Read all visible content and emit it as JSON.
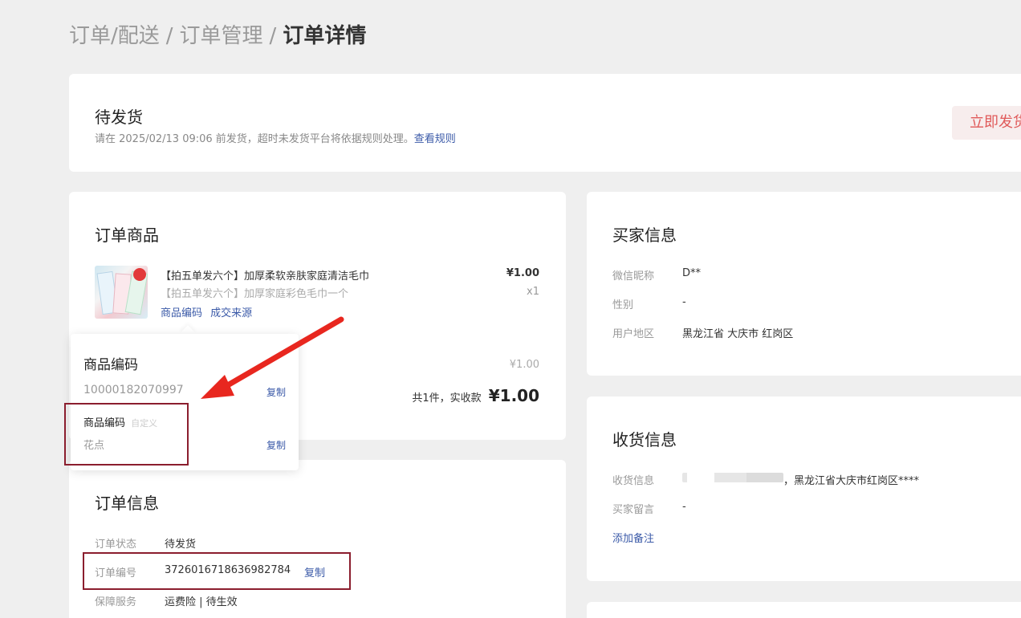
{
  "breadcrumb": {
    "part1": "订单/配送",
    "sep1": "/",
    "part2": "订单管理",
    "sep2": "/",
    "current": "订单详情"
  },
  "status": {
    "title": "待发货",
    "desc": "请在 2025/02/13 09:06 前发货，超时未发货平台将依据规则处理。",
    "link": "查看规则",
    "ship_button": "立即发货"
  },
  "order_items": {
    "title": "订单商品",
    "product": {
      "name": "【拍五单发六个】加厚柔软亲肤家庭清洁毛巾",
      "spec": "【拍五单发六个】加厚家庭彩色毛巾一个",
      "price": "¥1.00",
      "qty": "x1",
      "code_link": "商品编码",
      "source_link": "成交来源"
    },
    "subtotal": "¥1.00",
    "total_label": "共1件，实收款",
    "total_value": "¥1.00"
  },
  "popover": {
    "title": "商品编码",
    "code": "10000182070997",
    "copy1": "复制",
    "custom_label": "商品编码",
    "custom_tag": "自定义",
    "custom_value": "花点",
    "copy2": "复制"
  },
  "order_info": {
    "title": "订单信息",
    "rows": [
      {
        "label": "订单状态",
        "value": "待发货"
      },
      {
        "label": "订单编号",
        "value": "3726016718636982784",
        "action": "复制"
      },
      {
        "label": "保障服务",
        "value": "运费险 | 待生效"
      }
    ]
  },
  "buyer": {
    "title": "买家信息",
    "rows": [
      {
        "label": "微信昵称",
        "value": "D**"
      },
      {
        "label": "性别",
        "value": "-"
      },
      {
        "label": "用户地区",
        "value": "黑龙江省 大庆市 红岗区"
      }
    ]
  },
  "shipping": {
    "title": "收货信息",
    "rows": [
      {
        "label": "收货信息",
        "value": "，黑龙江省大庆市红岗区****"
      },
      {
        "label": "买家留言",
        "value": "-"
      }
    ],
    "add_note": "添加备注"
  },
  "colors": {
    "accent_red": "#e05a5a",
    "link_blue": "#3b5aa8",
    "highlight_box": "#8b1e2e",
    "arrow": "#e8271f"
  }
}
